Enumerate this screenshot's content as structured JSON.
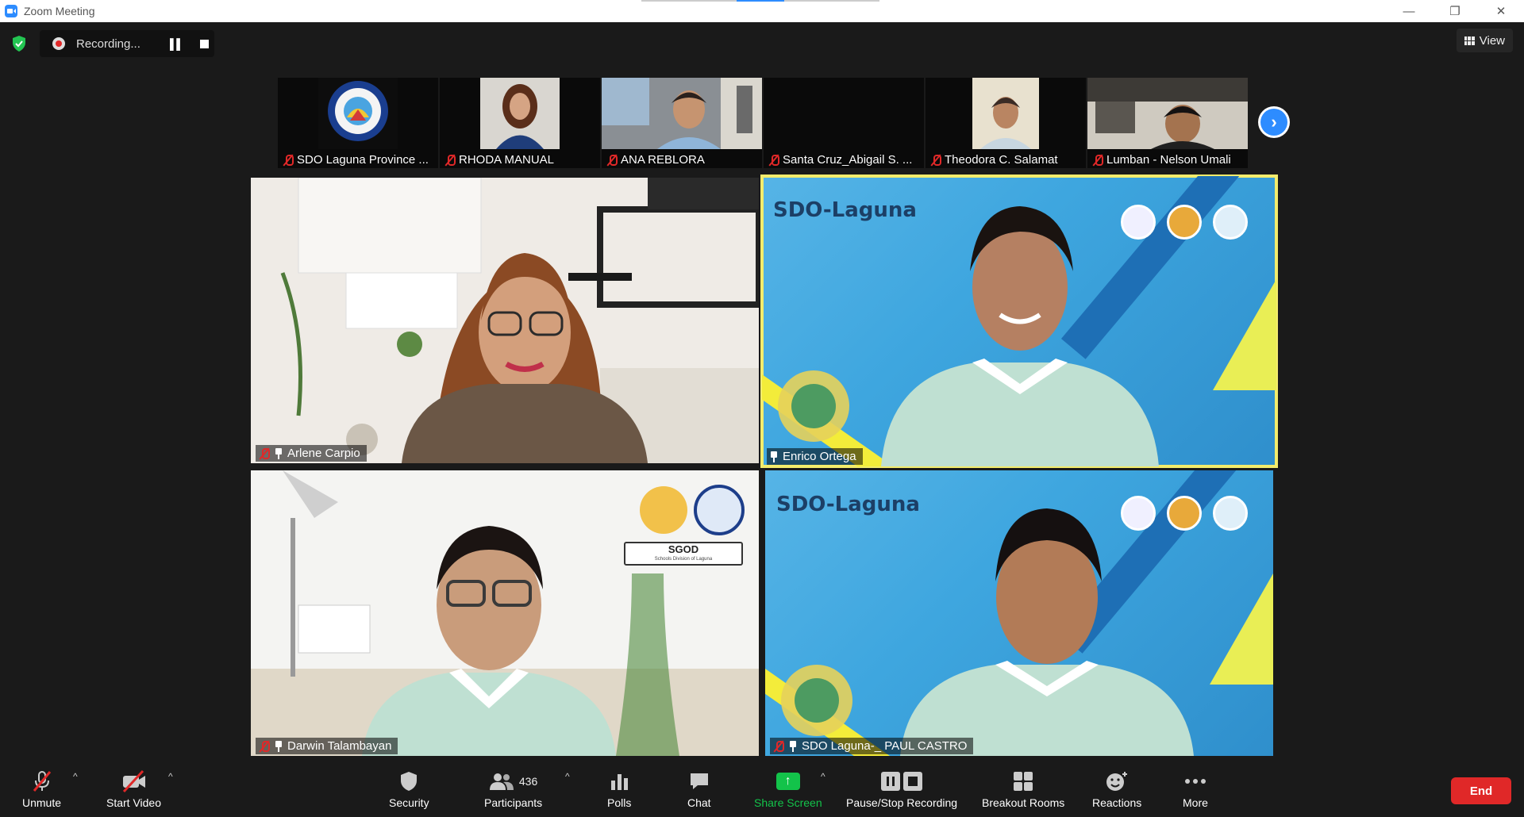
{
  "window": {
    "title": "Zoom Meeting",
    "controls": [
      "—",
      "❐",
      "✕"
    ]
  },
  "recording": {
    "status": "Recording..."
  },
  "view_button": {
    "label": "View"
  },
  "thumbnails": [
    {
      "name": "SDO Laguna Province ..."
    },
    {
      "name": "RHODA MANUAL"
    },
    {
      "name": "ANA REBLORA"
    },
    {
      "name": "Santa Cruz_Abigail S. ..."
    },
    {
      "name": "Theodora C. Salamat"
    },
    {
      "name": "Lumban - Nelson Umali"
    }
  ],
  "tiles": [
    {
      "name": "Arlene Carpio"
    },
    {
      "name": "Enrico Ortega",
      "brand": "SDO-Laguna"
    },
    {
      "name": "Darwin Talambayan",
      "sign": "SGOD",
      "sign_sub": "Schools Division of Laguna"
    },
    {
      "name": "SDO Laguna-_ PAUL CASTRO",
      "brand": "SDO-Laguna"
    }
  ],
  "toolbar": {
    "unmute": "Unmute",
    "start_video": "Start Video",
    "security": "Security",
    "participants": "Participants",
    "participants_count": "436",
    "polls": "Polls",
    "chat": "Chat",
    "share_screen": "Share Screen",
    "pause_stop_recording": "Pause/Stop Recording",
    "breakout_rooms": "Breakout Rooms",
    "reactions": "Reactions",
    "more": "More",
    "end": "End"
  },
  "colors": {
    "accent": "#2d8cff",
    "active_speaker_border": "#f3ec6c",
    "share_green": "#13c34a",
    "end_red": "#e02828",
    "muted_red": "#e02828"
  }
}
